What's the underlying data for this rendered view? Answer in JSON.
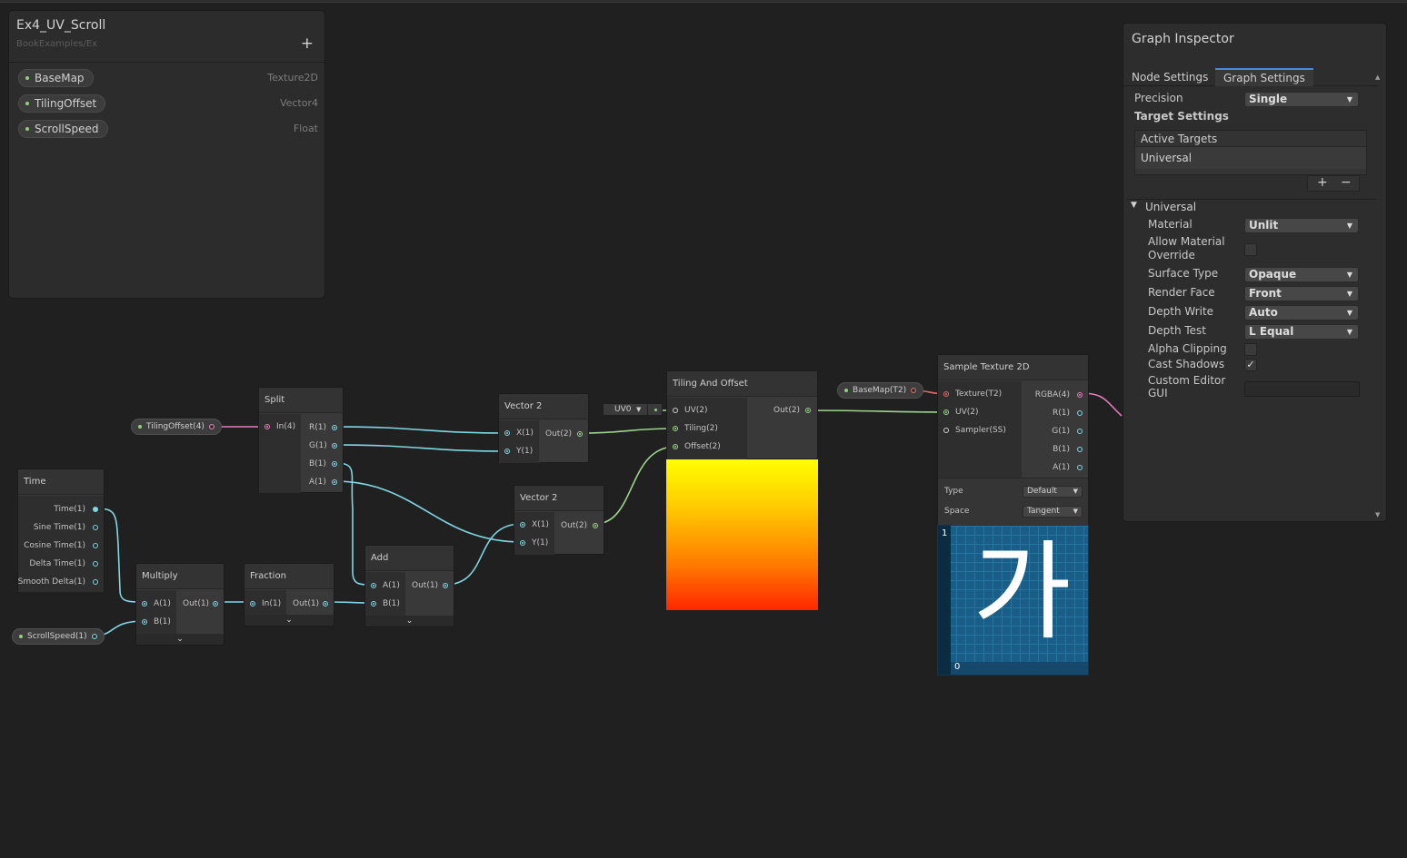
{
  "blackboard": {
    "title": "Ex4_UV_Scroll",
    "path": "BookExamples/Ex",
    "add_icon": "+",
    "properties": [
      {
        "name": "BaseMap",
        "type": "Texture2D"
      },
      {
        "name": "TilingOffset",
        "type": "Vector4"
      },
      {
        "name": "ScrollSpeed",
        "type": "Float"
      }
    ]
  },
  "property_nodes": {
    "tiling_offset": "TilingOffset(4)",
    "scroll_speed": "ScrollSpeed(1)",
    "base_map": "BaseMap(T2)"
  },
  "nodes": {
    "time": {
      "title": "Time",
      "outputs": [
        "Time(1)",
        "Sine Time(1)",
        "Cosine Time(1)",
        "Delta Time(1)",
        "Smooth Delta(1)"
      ]
    },
    "multiply": {
      "title": "Multiply",
      "inputs": [
        "A(1)",
        "B(1)"
      ],
      "output": "Out(1)"
    },
    "fraction": {
      "title": "Fraction",
      "input": "In(1)",
      "output": "Out(1)"
    },
    "add": {
      "title": "Add",
      "inputs": [
        "A(1)",
        "B(1)"
      ],
      "output": "Out(1)"
    },
    "split": {
      "title": "Split",
      "input": "In(4)",
      "outputs": [
        "R(1)",
        "G(1)",
        "B(1)",
        "A(1)"
      ]
    },
    "vector2_top": {
      "title": "Vector 2",
      "inputs": [
        "X(1)",
        "Y(1)"
      ],
      "output": "Out(2)"
    },
    "vector2_bottom": {
      "title": "Vector 2",
      "inputs": [
        "X(1)",
        "Y(1)"
      ],
      "output": "Out(2)"
    },
    "tiling_and_offset": {
      "title": "Tiling And Offset",
      "inputs": [
        "UV(2)",
        "Tiling(2)",
        "Offset(2)"
      ],
      "output": "Out(2)",
      "uv_channel": "UV0"
    },
    "sample_texture": {
      "title": "Sample Texture 2D",
      "inputs": [
        "Texture(T2)",
        "UV(2)",
        "Sampler(SS)"
      ],
      "outputs": [
        "RGBA(4)",
        "R(1)",
        "G(1)",
        "B(1)",
        "A(1)"
      ],
      "type_label": "Type",
      "type_value": "Default",
      "space_label": "Space",
      "space_value": "Tangent",
      "preview_top_label": "1",
      "preview_bottom_label": "0",
      "preview_glyph": "가"
    }
  },
  "inspector": {
    "title": "Graph Inspector",
    "tabs": [
      "Node Settings",
      "Graph Settings"
    ],
    "active_tab": "Graph Settings",
    "precision_label": "Precision",
    "precision_value": "Single",
    "target_settings_label": "Target Settings",
    "active_targets_label": "Active Targets",
    "active_target": "Universal",
    "add_label": "+",
    "remove_label": "−",
    "section": "Universal",
    "material_label": "Material",
    "material_value": "Unlit",
    "allow_override_label_1": "Allow Material",
    "allow_override_label_2": "Override",
    "surface_label": "Surface Type",
    "surface_value": "Opaque",
    "render_face_label": "Render Face",
    "render_face_value": "Front",
    "depth_write_label": "Depth Write",
    "depth_write_value": "Auto",
    "depth_test_label": "Depth Test",
    "depth_test_value": "L Equal",
    "alpha_clip_label": "Alpha Clipping",
    "cast_shadows_label": "Cast Shadows",
    "cast_shadows_check": "✓",
    "custom_gui_label_1": "Custom Editor",
    "custom_gui_label_2": "GUI"
  },
  "colors": {
    "float_wire": "#7fd6e4",
    "vector2_wire": "#9bd68c",
    "vector4_wire": "#e97bc0",
    "texture_wire": "#e06a6a",
    "accent": "#4a8ad8"
  }
}
